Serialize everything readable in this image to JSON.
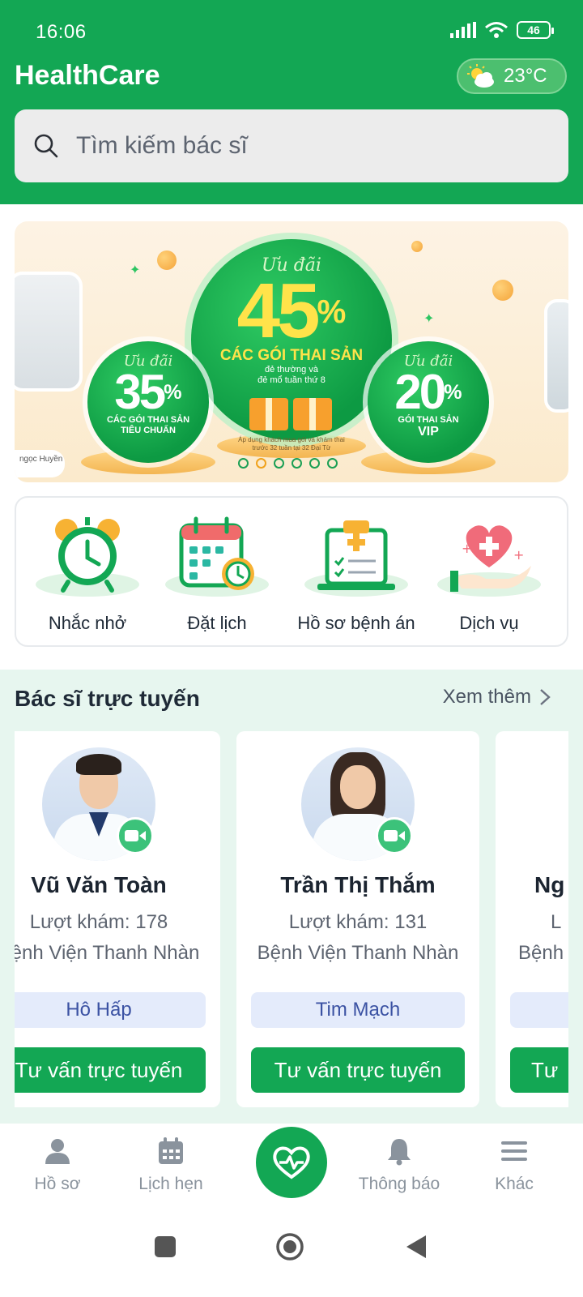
{
  "status_bar": {
    "time": "16:06",
    "battery": "46"
  },
  "header": {
    "app_title": "HealthCare",
    "weather": {
      "temperature": "23°C",
      "icon": "partly-cloudy-icon"
    }
  },
  "search": {
    "placeholder": "Tìm kiếm bác sĩ",
    "icon": "search-icon"
  },
  "banner": {
    "main": {
      "uu_dai": "Ưu đãi",
      "percent": "45",
      "title": "CÁC GÓI THAI SẢN",
      "subtitle_1": "đẻ thường và",
      "subtitle_2": "đẻ mổ tuần thứ 8"
    },
    "left": {
      "uu_dai": "Ưu đãi",
      "percent": "35",
      "line_1": "CÁC GÓI THAI SẢN",
      "line_2": "TIÊU CHUẨN"
    },
    "right": {
      "uu_dai": "Ưu đãi",
      "percent": "20",
      "line_1": "GÓI THAI SẢN",
      "line_2": "VIP"
    },
    "note_1": "Áp dụng khách mua gói và khám thai",
    "note_2": "trước 32 tuần tại 32 Đại Từ",
    "name_tag": "ngọc Huyền",
    "slide_count": 6,
    "active_slide": 2
  },
  "quick_actions": [
    {
      "label": "Nhắc nhở",
      "icon": "alarm-clock-icon"
    },
    {
      "label": "Đặt lịch",
      "icon": "calendar-clock-icon"
    },
    {
      "label": "Hồ sơ bệnh án",
      "icon": "clipboard-laptop-icon"
    },
    {
      "label": "Dịch vụ",
      "icon": "heart-hand-icon"
    }
  ],
  "doctors_section": {
    "title": "Bác sĩ trực tuyến",
    "see_more": "Xem thêm",
    "doctors": [
      {
        "name": "Vũ Văn Toàn",
        "visits": "Lượt khám: 178",
        "hospital": "Bệnh Viện Thanh Nhàn",
        "specialty": "Hô Hấp",
        "button": "Tư vấn trực tuyến"
      },
      {
        "name": "Trần Thị Thắm",
        "visits": "Lượt khám: 131",
        "hospital": "Bệnh Viện Thanh Nhàn",
        "specialty": "Tim Mạch",
        "button": "Tư vấn trực tuyến"
      },
      {
        "name": "Ng",
        "visits": "L",
        "hospital": "Bệnh",
        "specialty": "",
        "button": "Tư"
      }
    ]
  },
  "bottom_nav": [
    {
      "label": "Hồ sơ",
      "icon": "person-icon"
    },
    {
      "label": "Lịch hẹn",
      "icon": "calendar-icon"
    },
    {
      "label": "",
      "icon": "heart-pulse-icon"
    },
    {
      "label": "Thông báo",
      "icon": "bell-icon"
    },
    {
      "label": "Khác",
      "icon": "menu-icon"
    }
  ],
  "colors": {
    "primary": "#13a754",
    "section_bg": "#e7f6ef",
    "specialty_bg": "#e4ebfb",
    "specialty_text": "#3b52a3"
  }
}
